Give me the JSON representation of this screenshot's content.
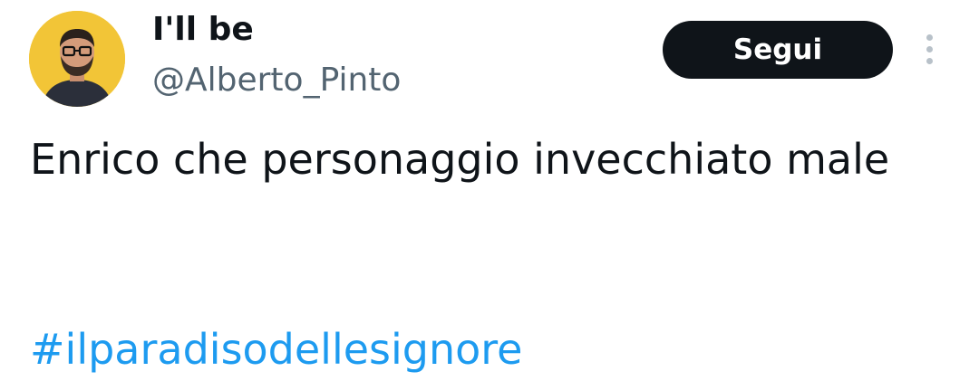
{
  "author": {
    "display_name": "I'll be",
    "handle": "@Alberto_Pinto",
    "avatar_icon": "profile-photo"
  },
  "actions": {
    "follow_label": "Segui",
    "more_icon": "vertical-ellipsis-icon"
  },
  "tweet": {
    "text": "Enrico che personaggio invecchiato male",
    "hashtag": "#ilparadisodellesignore"
  },
  "colors": {
    "hashtag_link": "#1d9bf0",
    "follow_button_bg": "#0f1419",
    "avatar_bg": "#f2c537",
    "handle_gray": "#536471"
  }
}
